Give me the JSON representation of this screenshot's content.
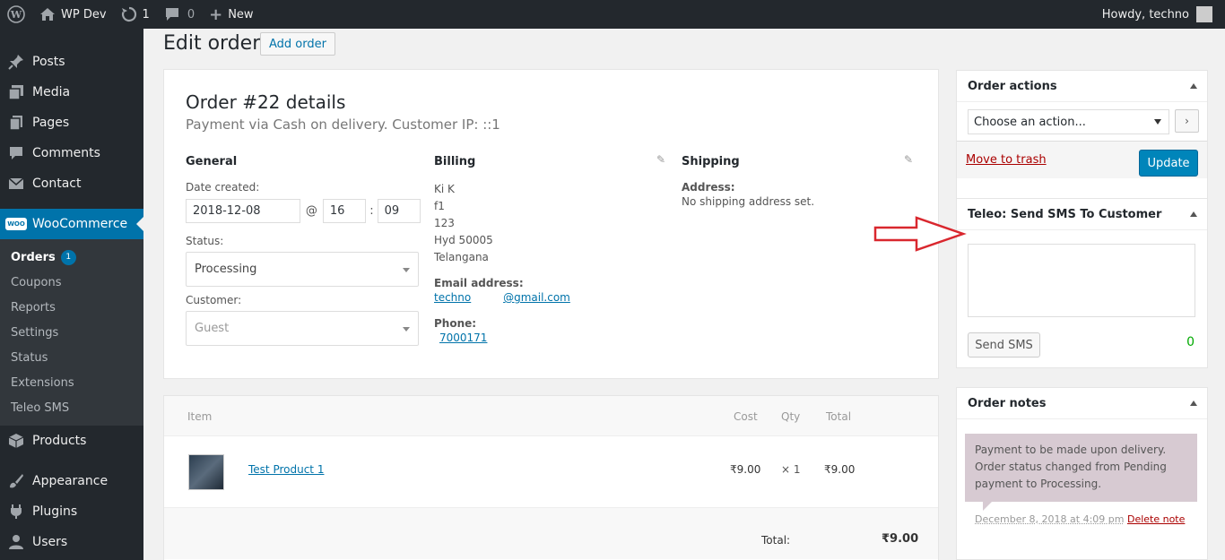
{
  "adminbar": {
    "site_name": "WP Dev",
    "updates_count": "1",
    "comments_count": "0",
    "new_label": "New",
    "howdy": "Howdy, techno"
  },
  "sidebar": {
    "items": [
      {
        "label": "Posts",
        "icon": "pin-icon"
      },
      {
        "label": "Media",
        "icon": "media-icon"
      },
      {
        "label": "Pages",
        "icon": "pages-icon"
      },
      {
        "label": "Comments",
        "icon": "comment-icon"
      },
      {
        "label": "Contact",
        "icon": "mail-icon"
      }
    ],
    "woocommerce": "WooCommerce",
    "woo_icon_text": "WOO",
    "submenu": [
      {
        "label": "Orders",
        "badge": "1"
      },
      {
        "label": "Coupons"
      },
      {
        "label": "Reports"
      },
      {
        "label": "Settings"
      },
      {
        "label": "Status"
      },
      {
        "label": "Extensions"
      },
      {
        "label": "Teleo SMS"
      }
    ],
    "after": [
      {
        "label": "Products",
        "icon": "box-icon"
      },
      {
        "label": "Appearance",
        "icon": "brush-icon"
      },
      {
        "label": "Plugins",
        "icon": "plug-icon"
      },
      {
        "label": "Users",
        "icon": "user-icon"
      }
    ]
  },
  "header": {
    "title": "Edit order",
    "add_button": "Add order"
  },
  "order": {
    "title": "Order #22 details",
    "subtitle": "Payment via Cash on delivery. Customer IP: ::1",
    "general": {
      "heading": "General",
      "date_label": "Date created:",
      "date": "2018-12-08",
      "at": "@",
      "hour": "16",
      "colon": ":",
      "minute": "09",
      "status_label": "Status:",
      "status": "Processing",
      "customer_label": "Customer:",
      "customer": "Guest"
    },
    "billing": {
      "heading": "Billing",
      "lines": [
        "Ki K",
        "f1",
        "123",
        "Hyd 50005",
        "Telangana"
      ],
      "email_label": "Email address:",
      "email_user": "techno",
      "email_domain": "@gmail.com",
      "phone_label": "Phone:",
      "phone": "7000171"
    },
    "shipping": {
      "heading": "Shipping",
      "address_label": "Address:",
      "address_value": "No shipping address set."
    }
  },
  "items": {
    "headers": {
      "item": "Item",
      "cost": "Cost",
      "qty": "Qty",
      "total": "Total"
    },
    "rows": [
      {
        "name": "Test Product 1",
        "cost": "₹9.00",
        "qty": "× 1",
        "total": "₹9.00"
      }
    ],
    "total_label": "Total:",
    "total_value": "₹9.00"
  },
  "actions_box": {
    "title": "Order actions",
    "select_placeholder": "Choose an action...",
    "go": "›",
    "trash": "Move to trash",
    "update": "Update"
  },
  "sms_box": {
    "title": "Teleo: Send SMS To Customer",
    "send": "Send SMS",
    "count": "0"
  },
  "notes_box": {
    "title": "Order notes",
    "note": "Payment to be made upon delivery. Order status changed from Pending payment to Processing.",
    "meta": "December 8, 2018 at 4:09 pm",
    "delete": "Delete note"
  },
  "colors": {
    "admin_bar": "#23282d",
    "accent": "#0073aa",
    "update_button": "#0085ba",
    "arrow": "#d9272e"
  }
}
